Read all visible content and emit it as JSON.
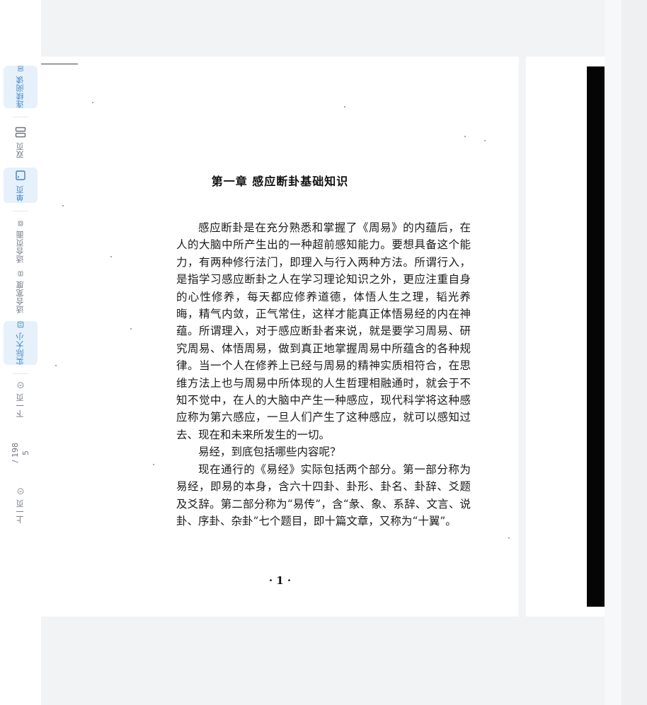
{
  "toolbar": {
    "continuous": {
      "label": "连续阅读",
      "icon": "continuous-read-icon"
    },
    "double": {
      "label": "双页",
      "icon": "double-page-icon"
    },
    "single": {
      "label": "单页",
      "icon": "single-page-icon"
    },
    "fit_page": {
      "label": "适合页面",
      "icon": "fit-page-icon"
    },
    "fit_width": {
      "label": "适合宽度",
      "icon": "fit-width-icon"
    },
    "actual_size": {
      "label": "实际大小",
      "icon": "actual-size-icon"
    },
    "next": {
      "label": "下一页",
      "icon": "chevron-down-circle-icon"
    },
    "prev": {
      "label": "上一页",
      "icon": "chevron-up-circle-icon"
    },
    "page_current": "5",
    "page_total": "/ 198"
  },
  "document": {
    "chapter_title": "第一章 感应断卦基础知识",
    "paragraphs": [
      "感应断卦是在充分熟悉和掌握了《周易》的内蕴后，在人的大脑中所产生出的一种超前感知能力。要想具备这个能力，有两种修行法门，即理入与行入两种方法。所谓行入，是指学习感应断卦之人在学习理论知识之外，更应注重自身的心性修养，每天都应修养道德，体悟人生之理，韬光养晦，精气内敛，正气常住，这样才能真正体悟易经的内在神蕴。所谓理入，对于感应断卦者来说，就是要学习周易、研究周易、体悟周易，做到真正地掌握周易中所蕴含的各种规律。当一个人在修养上已经与周易的精神实质相符合，在思维方法上也与周易中所体现的人生哲理相融通时，就会于不知不觉中，在人的大脑中产生一种感应，现代科学将这种感应称为第六感应，一旦人们产生了这种感应，就可以感知过去、现在和未来所发生的一切。",
      "易经，到底包括哪些内容呢？",
      "现在通行的《易经》实际包括两个部分。第一部分称为易经，即易的本身，含六十四卦、卦形、卦名、卦辞、爻题及爻辞。第二部分称为“易传”，含“彖、象、系辞、文言、说卦、序卦、杂卦”七个题目，即十篇文章，又称为“十翼”。"
    ],
    "page_number": "· 1 ·"
  },
  "colors": {
    "active_bg": "#e6f1fb",
    "active_fg": "#3b82c4",
    "inactive_fg": "#6b7280",
    "viewer_bg": "#f2f3f5"
  }
}
